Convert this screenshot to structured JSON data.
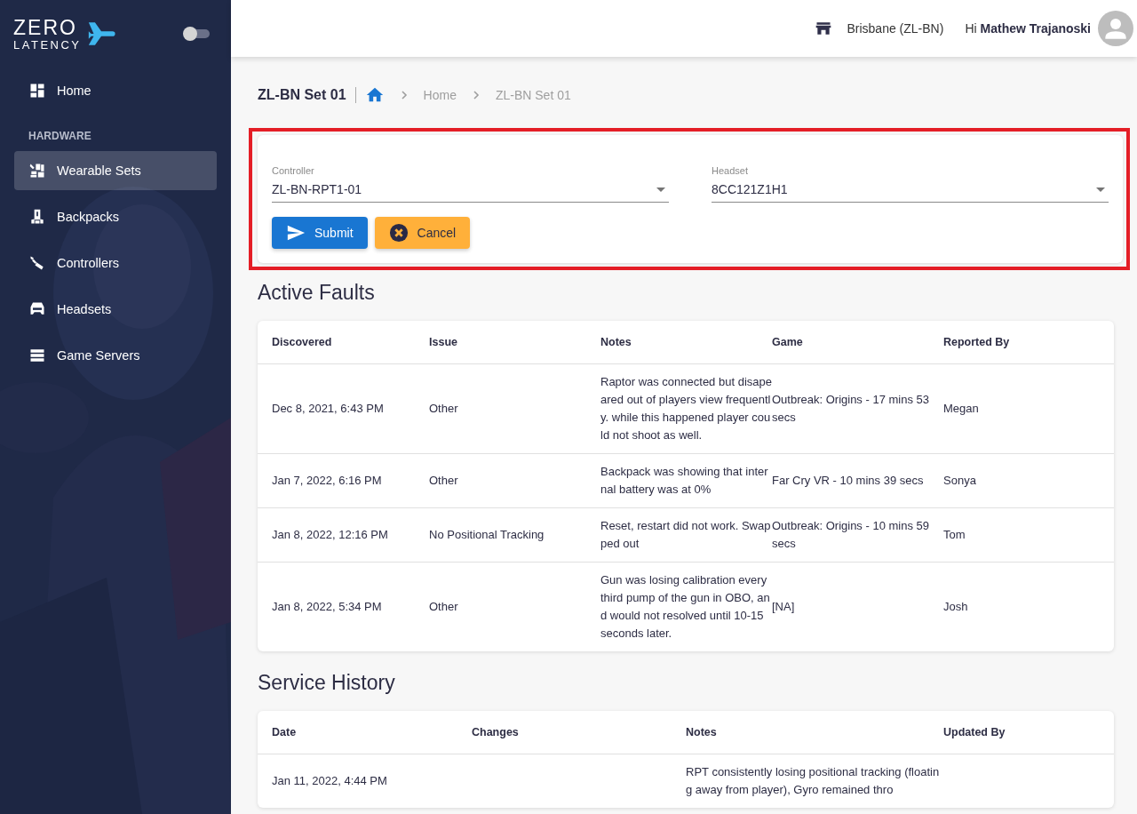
{
  "sidebar": {
    "logo": {
      "line1": "ZERO",
      "line2": "LATENCY"
    },
    "theme_toggle": {
      "on": false
    },
    "items": [
      {
        "kind": "link",
        "label": "Home",
        "selected": false
      },
      {
        "kind": "section",
        "label": "HARDWARE"
      },
      {
        "kind": "link",
        "label": "Wearable Sets",
        "selected": true
      },
      {
        "kind": "link",
        "label": "Backpacks",
        "selected": false
      },
      {
        "kind": "link",
        "label": "Controllers",
        "selected": false
      },
      {
        "kind": "link",
        "label": "Headsets",
        "selected": false
      },
      {
        "kind": "link",
        "label": "Game Servers",
        "selected": false
      }
    ]
  },
  "header": {
    "location": "Brisbane (ZL-BN)",
    "greeting": "Hi **Mathew Trajanoski**"
  },
  "page": {
    "title": "ZL-BN Set 01",
    "breadcrumb": [
      "Home",
      "ZL-BN Set 01"
    ]
  },
  "form": {
    "highlighted": true,
    "fields": [
      {
        "label": "Controller",
        "value": "ZL-BN-RPT1-01"
      },
      {
        "label": "Headset",
        "value": "8CC121Z1H1"
      }
    ],
    "buttons": [
      {
        "kind": "submit",
        "label": "Submit"
      },
      {
        "kind": "cancel",
        "label": "Cancel"
      }
    ]
  },
  "active_faults": {
    "title": "Active Faults",
    "columns": [
      "Discovered",
      "Issue",
      "Notes",
      "Game",
      "Reported By"
    ],
    "rows": [
      [
        "Dec 8, 2021, 6:43 PM",
        "Other",
        "Raptor was connected but disapeared out of players view frequently. while this happened player could not shoot as well.",
        "Outbreak: Origins - 17 mins 53 secs",
        "Megan"
      ],
      [
        "Jan 7, 2022, 6:16 PM",
        "Other",
        "Backpack was showing that internal battery was at 0%",
        "Far Cry VR - 10 mins 39 secs",
        "Sonya"
      ],
      [
        "Jan 8, 2022, 12:16 PM",
        "No Positional Tracking",
        "Reset, restart did not work. Swapped out",
        "Outbreak: Origins - 10 mins 59 secs",
        "Tom"
      ],
      [
        "Jan 8, 2022, 5:34 PM",
        "Other",
        "Gun was losing calibration every third pump of the gun in OBO, and would not resolved until 10-15 seconds later.",
        "[NA]",
        "Josh"
      ]
    ]
  },
  "service_history": {
    "title": "Service History",
    "columns": [
      "Date",
      "Changes",
      "Notes",
      "Updated By"
    ],
    "rows": [
      [
        "Jan 11, 2022, 4:44 PM",
        "",
        "RPT consistently losing positional tracking (floating away from player), Gyro remained thro",
        ""
      ]
    ]
  }
}
